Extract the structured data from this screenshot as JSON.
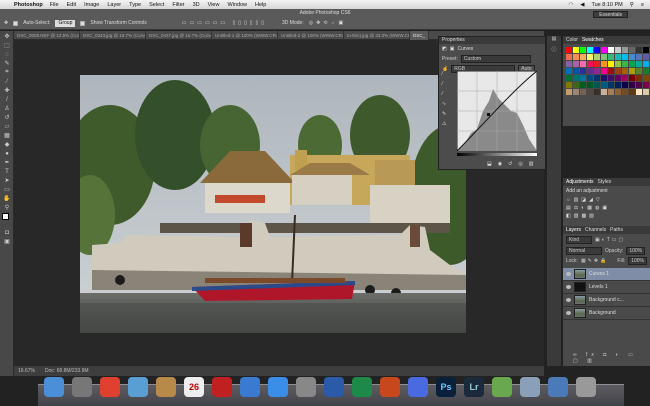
{
  "menubar": {
    "app": "Photoshop",
    "items": [
      "File",
      "Edit",
      "Image",
      "Layer",
      "Type",
      "Select",
      "Filter",
      "3D",
      "View",
      "Window",
      "Help"
    ],
    "clock": "Tue 8:10 PM"
  },
  "window_title": "Adobe Photoshop CS6",
  "options": {
    "auto_select_label": "Auto-Select:",
    "auto_select_value": "Group",
    "transform_controls_label": "Show Transform Controls",
    "mode_3d_label": "3D Mode:",
    "workspace": "Essentials"
  },
  "tabs": [
    {
      "label": "DSC_0009.NEF @ 12.5% (Curves"
    },
    {
      "label": "DSC_0343.jpg @ 16.7% (Curves..."
    },
    {
      "label": "DSC_0437.jpg @ 16.7% (Curves S..."
    },
    {
      "label": "Untitled-1 @ 100% (WWW.CRAFT..."
    },
    {
      "label": "Untitled-2 @ 100% (WWW.CRAFT..."
    },
    {
      "label": "to-thin).jpg @ 33.3% (WWW.CRAFT..."
    },
    {
      "label": "DSC_"
    }
  ],
  "status": {
    "zoom": "16.67%",
    "doc": "Doc: 68.8M/233.9M"
  },
  "properties": {
    "title": "Properties",
    "panel": "Curves",
    "preset_label": "Preset:",
    "preset_value": "Custom",
    "channel": "RGB",
    "auto": "Auto"
  },
  "swatches": {
    "tabs": [
      "Color",
      "Swatches"
    ],
    "colors": [
      "#ff0000",
      "#ffff00",
      "#00ff00",
      "#00ffff",
      "#0000ff",
      "#ff00ff",
      "#ffffff",
      "#cccccc",
      "#999999",
      "#666666",
      "#333333",
      "#000000",
      "#f26c4f",
      "#f68e55",
      "#fbaf5c",
      "#fff467",
      "#acd372",
      "#7cc576",
      "#3bb878",
      "#1abbb4",
      "#00bff3",
      "#438cca",
      "#5574b9",
      "#605ca8",
      "#855fa8",
      "#a763a8",
      "#f06ea9",
      "#ed145b",
      "#ed1c24",
      "#f7941d",
      "#fff200",
      "#8dc63f",
      "#39b54a",
      "#00a651",
      "#00a99d",
      "#00aeef",
      "#0072bc",
      "#0054a6",
      "#2e3192",
      "#662d91",
      "#92278f",
      "#ec008c",
      "#9e0b0f",
      "#a0410d",
      "#a36209",
      "#aba000",
      "#598527",
      "#1a7b30",
      "#007236",
      "#00746b",
      "#0076a3",
      "#004b80",
      "#003471",
      "#1b1464",
      "#440e62",
      "#630460",
      "#9e005d",
      "#790000",
      "#7b2e00",
      "#7d4900",
      "#827b00",
      "#406618",
      "#005e20",
      "#005826",
      "#005952",
      "#005b7f",
      "#003663",
      "#002157",
      "#0d004c",
      "#32004b",
      "#4b0049",
      "#7b0046",
      "#c69c6d",
      "#998675",
      "#736357",
      "#534741",
      "#37302d",
      "#c7b299",
      "#a67c52",
      "#8c6239",
      "#754c24",
      "#603913",
      "#ffe4c4",
      "#e0c9a6"
    ]
  },
  "adjustments": {
    "tabs": [
      "Adjustments",
      "Styles"
    ],
    "hint": "Add an adjustment"
  },
  "layers": {
    "tabs": [
      "Layers",
      "Channels",
      "Paths"
    ],
    "kind": "Kind",
    "blend": "Normal",
    "opacity_label": "Opacity:",
    "opacity": "100%",
    "lock_label": "Lock:",
    "fill_label": "Fill:",
    "fill": "100%",
    "items": [
      {
        "name": "Curves 1",
        "thumb": "photo",
        "selected": true
      },
      {
        "name": "Levels 1",
        "thumb": "dark",
        "selected": false
      },
      {
        "name": "Background c...",
        "thumb": "photo",
        "selected": false
      },
      {
        "name": "Background",
        "thumb": "photo",
        "selected": false
      }
    ]
  },
  "dock": {
    "icons": [
      "finder-icon",
      "launchpad-icon",
      "chrome-icon",
      "mail-icon",
      "contacts-icon",
      "calendar-icon",
      "photo-booth-icon",
      "itunes-icon",
      "app-store-icon",
      "preferences-icon",
      "word-icon",
      "excel-icon",
      "powerpoint-icon",
      "help-icon",
      "photoshop-icon",
      "lightroom-icon",
      "evernote-icon",
      "preview-icon",
      "downloads-icon",
      "trash-icon"
    ],
    "calendar_day": "26",
    "ps_label": "Ps",
    "lr_label": "Lr"
  }
}
